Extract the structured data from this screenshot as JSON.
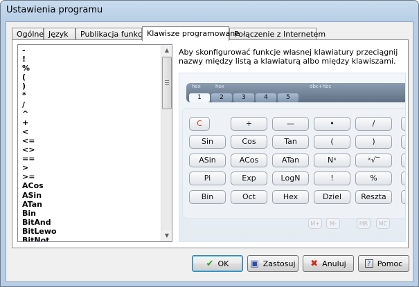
{
  "window": {
    "title": "Ustawienia programu"
  },
  "tabs": [
    {
      "label": "Ogólne"
    },
    {
      "label": "Język"
    },
    {
      "label": "Publikacja funkcji"
    },
    {
      "label": "Klawisze programowane"
    },
    {
      "label": "Połączenie z Internetem"
    }
  ],
  "active_tab": "Klawisze programowane",
  "function_list": {
    "items": [
      "-",
      "!",
      "%",
      "(",
      ")",
      "*",
      "/",
      "^",
      "+",
      "<",
      "<=",
      "<>",
      "==",
      ">",
      ">=",
      "ACos",
      "ASin",
      "ATan",
      "Bin",
      "BitAnd",
      "BitLewo",
      "BitNot"
    ]
  },
  "instructions": "Aby skonfigurować funkcje własnej klawiatury przeciągnij nazwy między listą a klawiaturą albo między klawiszami.",
  "keyboard": {
    "display_tabs": [
      "hex",
      "hex"
    ],
    "display_right": "dbc+hbc",
    "pad_tabs": [
      "1",
      "2",
      "3",
      "4",
      "5"
    ],
    "active_pad": "1",
    "rows": [
      [
        "C",
        "+",
        "—",
        "•",
        "/"
      ],
      [
        "Sin",
        "Cos",
        "Tan",
        "(",
        ")"
      ],
      [
        "ASin",
        "ACos",
        "ATan",
        "Nˣ",
        "ˣ√‾"
      ],
      [
        "Pi",
        "Exp",
        "LogN",
        "!",
        "%"
      ],
      [
        "Bin",
        "Oct",
        "Hex",
        "Dziel",
        "Reszta"
      ]
    ],
    "faint_keys": [
      "M+",
      "M-",
      "MR",
      "MC"
    ]
  },
  "buttons": {
    "ok": "OK",
    "apply": "Zastosuj",
    "cancel": "Anuluj",
    "help": "Pomoc"
  },
  "colors": {
    "title_gradient": "#b7cee6",
    "ok_icon": "#3a9a2a",
    "cancel_icon": "#d02a1a",
    "accent_red_key": "#d23a2a"
  }
}
